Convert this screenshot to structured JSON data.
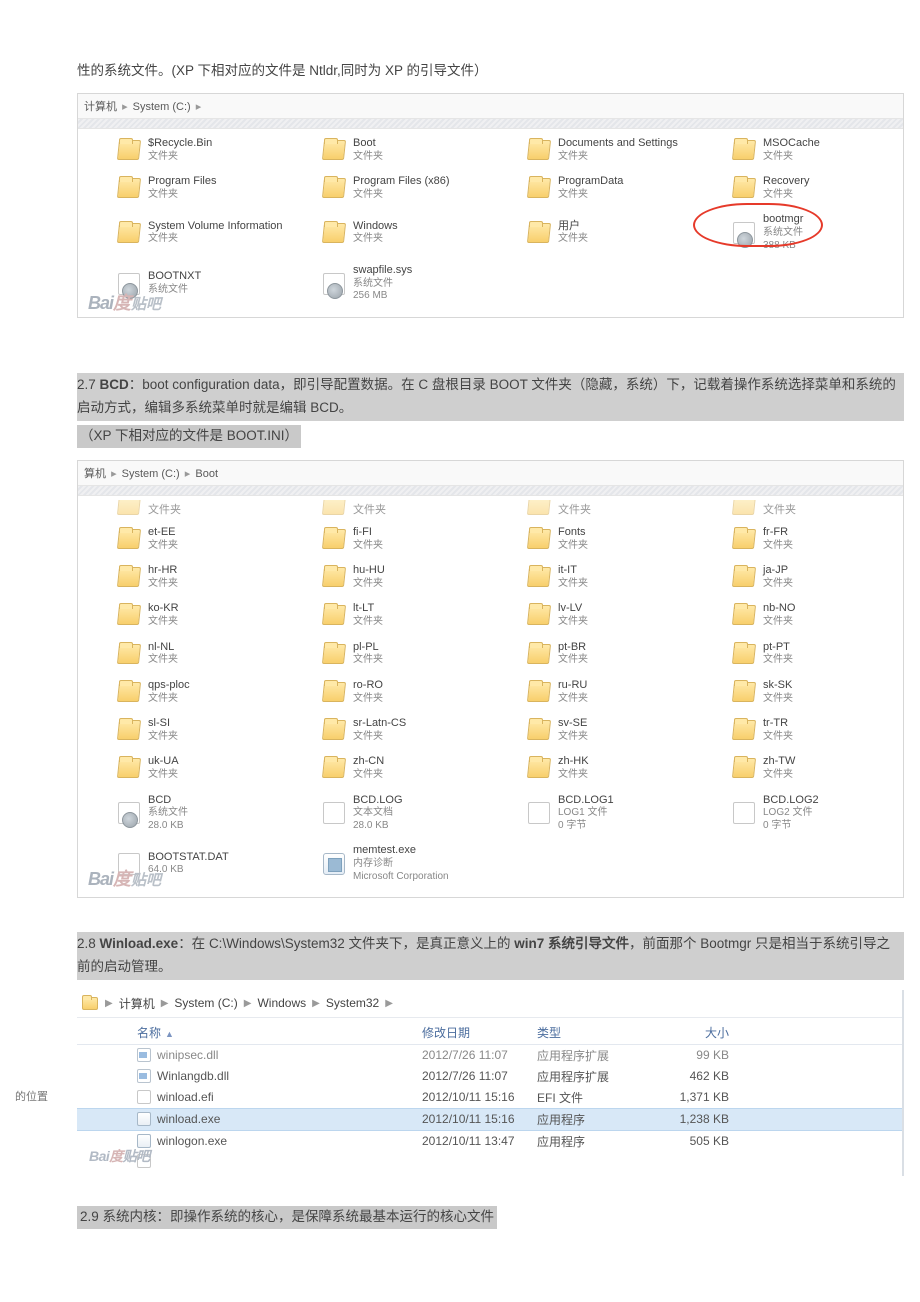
{
  "para1": "性的系统文件。(XP 下相对应的文件是 Ntldr,同时为 XP 的引导文件）",
  "breadcrumb1": {
    "seg1": "计算机",
    "seg2": "System (C:)"
  },
  "grid1": [
    {
      "name": "$Recycle.Bin",
      "l2": "文件夹",
      "ic": "folder"
    },
    {
      "name": "Boot",
      "l2": "文件夹",
      "ic": "folder"
    },
    {
      "name": "Documents and Settings",
      "l2": "文件夹",
      "ic": "folder"
    },
    {
      "name": "MSOCache",
      "l2": "文件夹",
      "ic": "folder"
    },
    {
      "name": "Program Files",
      "l2": "文件夹",
      "ic": "folder"
    },
    {
      "name": "Program Files (x86)",
      "l2": "文件夹",
      "ic": "folder"
    },
    {
      "name": "ProgramData",
      "l2": "文件夹",
      "ic": "folder"
    },
    {
      "name": "Recovery",
      "l2": "文件夹",
      "ic": "folder"
    },
    {
      "name": "System Volume Information",
      "l2": "文件夹",
      "ic": "folder"
    },
    {
      "name": "Windows",
      "l2": "文件夹",
      "ic": "folder"
    },
    {
      "name": "用户",
      "l2": "文件夹",
      "ic": "folder"
    },
    {
      "name": "bootmgr",
      "l2": "系统文件",
      "l3": "388 KB",
      "ic": "sys",
      "circle": true
    },
    {
      "name": "BOOTNXT",
      "l2": "系统文件",
      "l3": "",
      "ic": "sys"
    },
    {
      "name": "swapfile.sys",
      "l2": "系统文件",
      "l3": "256 MB",
      "ic": "sys"
    }
  ],
  "para27a": "2.7 ",
  "para27b": "BCD",
  "para27c": "：boot configuration data，即",
  "para27d": "引导配置数据",
  "para27e": "。在 C 盘根目录 BOOT 文件夹（隐藏，系统）下，记载着",
  "para27f": "操作系统选择菜单",
  "para27g": "和系统的启动方式，编辑多系统菜单时就是编辑 BCD。",
  "para27h": "（XP 下相对应的文件是 BOOT.INI）",
  "breadcrumb2": {
    "seg1": "算机",
    "seg2": "System (C:)",
    "seg3": "Boot"
  },
  "gridTopRow": [
    {
      "name": "文件夹"
    },
    {
      "name": "文件夹"
    },
    {
      "name": "文件夹"
    },
    {
      "name": "文件夹"
    }
  ],
  "grid2": [
    {
      "name": "et-EE",
      "l2": "文件夹",
      "ic": "folder"
    },
    {
      "name": "fi-FI",
      "l2": "文件夹",
      "ic": "folder"
    },
    {
      "name": "Fonts",
      "l2": "文件夹",
      "ic": "folder"
    },
    {
      "name": "fr-FR",
      "l2": "文件夹",
      "ic": "folder"
    },
    {
      "name": "hr-HR",
      "l2": "文件夹",
      "ic": "folder"
    },
    {
      "name": "hu-HU",
      "l2": "文件夹",
      "ic": "folder"
    },
    {
      "name": "it-IT",
      "l2": "文件夹",
      "ic": "folder"
    },
    {
      "name": "ja-JP",
      "l2": "文件夹",
      "ic": "folder"
    },
    {
      "name": "ko-KR",
      "l2": "文件夹",
      "ic": "folder"
    },
    {
      "name": "lt-LT",
      "l2": "文件夹",
      "ic": "folder"
    },
    {
      "name": "lv-LV",
      "l2": "文件夹",
      "ic": "folder"
    },
    {
      "name": "nb-NO",
      "l2": "文件夹",
      "ic": "folder"
    },
    {
      "name": "nl-NL",
      "l2": "文件夹",
      "ic": "folder"
    },
    {
      "name": "pl-PL",
      "l2": "文件夹",
      "ic": "folder"
    },
    {
      "name": "pt-BR",
      "l2": "文件夹",
      "ic": "folder"
    },
    {
      "name": "pt-PT",
      "l2": "文件夹",
      "ic": "folder"
    },
    {
      "name": "qps-ploc",
      "l2": "文件夹",
      "ic": "folder"
    },
    {
      "name": "ro-RO",
      "l2": "文件夹",
      "ic": "folder"
    },
    {
      "name": "ru-RU",
      "l2": "文件夹",
      "ic": "folder"
    },
    {
      "name": "sk-SK",
      "l2": "文件夹",
      "ic": "folder"
    },
    {
      "name": "sl-SI",
      "l2": "文件夹",
      "ic": "folder"
    },
    {
      "name": "sr-Latn-CS",
      "l2": "文件夹",
      "ic": "folder"
    },
    {
      "name": "sv-SE",
      "l2": "文件夹",
      "ic": "folder"
    },
    {
      "name": "tr-TR",
      "l2": "文件夹",
      "ic": "folder"
    },
    {
      "name": "uk-UA",
      "l2": "文件夹",
      "ic": "folder"
    },
    {
      "name": "zh-CN",
      "l2": "文件夹",
      "ic": "folder"
    },
    {
      "name": "zh-HK",
      "l2": "文件夹",
      "ic": "folder"
    },
    {
      "name": "zh-TW",
      "l2": "文件夹",
      "ic": "folder"
    },
    {
      "name": "BCD",
      "l2": "系统文件",
      "l3": "28.0 KB",
      "ic": "sys"
    },
    {
      "name": "BCD.LOG",
      "l2": "文本文档",
      "l3": "28.0 KB",
      "ic": "doc"
    },
    {
      "name": "BCD.LOG1",
      "l2": "LOG1 文件",
      "l3": "0 字节",
      "ic": "doc"
    },
    {
      "name": "BCD.LOG2",
      "l2": "LOG2 文件",
      "l3": "0 字节",
      "ic": "doc"
    },
    {
      "name": "BOOTSTAT.DAT",
      "l2": "",
      "l3": "64.0 KB",
      "ic": "doc"
    },
    {
      "name": "memtest.exe",
      "l2": "内存诊断",
      "l3": "Microsoft Corporation",
      "ic": "exe"
    }
  ],
  "para28a": "2.8 ",
  "para28b": "Winload.exe",
  "para28c": "：在 C:\\Windows\\System32 文件夹下，是真正意义上的 ",
  "para28d": "win7 系统引导文件",
  "para28e": "，前面那个 Bootmgr 只是相当于系统引导之前的启动管理。",
  "breadcrumb3": {
    "seg1": "计算机",
    "seg2": "System (C:)",
    "seg3": "Windows",
    "seg4": "System32"
  },
  "col": {
    "name": "名称",
    "date": "修改日期",
    "type": "类型",
    "size": "大小"
  },
  "rows3": [
    {
      "n": "winipsec.dll",
      "d": "2012/7/26 11:07",
      "t": "应用程序扩展",
      "s": "99 KB",
      "ic": "dll",
      "dim": true
    },
    {
      "n": "Winlangdb.dll",
      "d": "2012/7/26 11:07",
      "t": "应用程序扩展",
      "s": "462 KB",
      "ic": "dll"
    },
    {
      "n": "winload.efi",
      "d": "2012/10/11 15:16",
      "t": "EFI 文件",
      "s": "1,371 KB",
      "ic": "file"
    },
    {
      "n": "winload.exe",
      "d": "2012/10/11 15:16",
      "t": "应用程序",
      "s": "1,238 KB",
      "ic": "exe",
      "sel": true
    },
    {
      "n": "winlogon.exe",
      "d": "2012/10/11 13:47",
      "t": "应用程序",
      "s": "505 KB",
      "ic": "exe"
    },
    {
      "n": "",
      "d": "",
      "t": "",
      "s": "",
      "ic": "file",
      "dim": true
    }
  ],
  "leftTrunc": "的位置",
  "para29": "2.9 系统内核：即操作系统的核心，是保障系统最基本运行的核心文件",
  "watermark_bai": "Bai",
  "watermark_du": "度",
  "watermark_tie": "贴吧"
}
